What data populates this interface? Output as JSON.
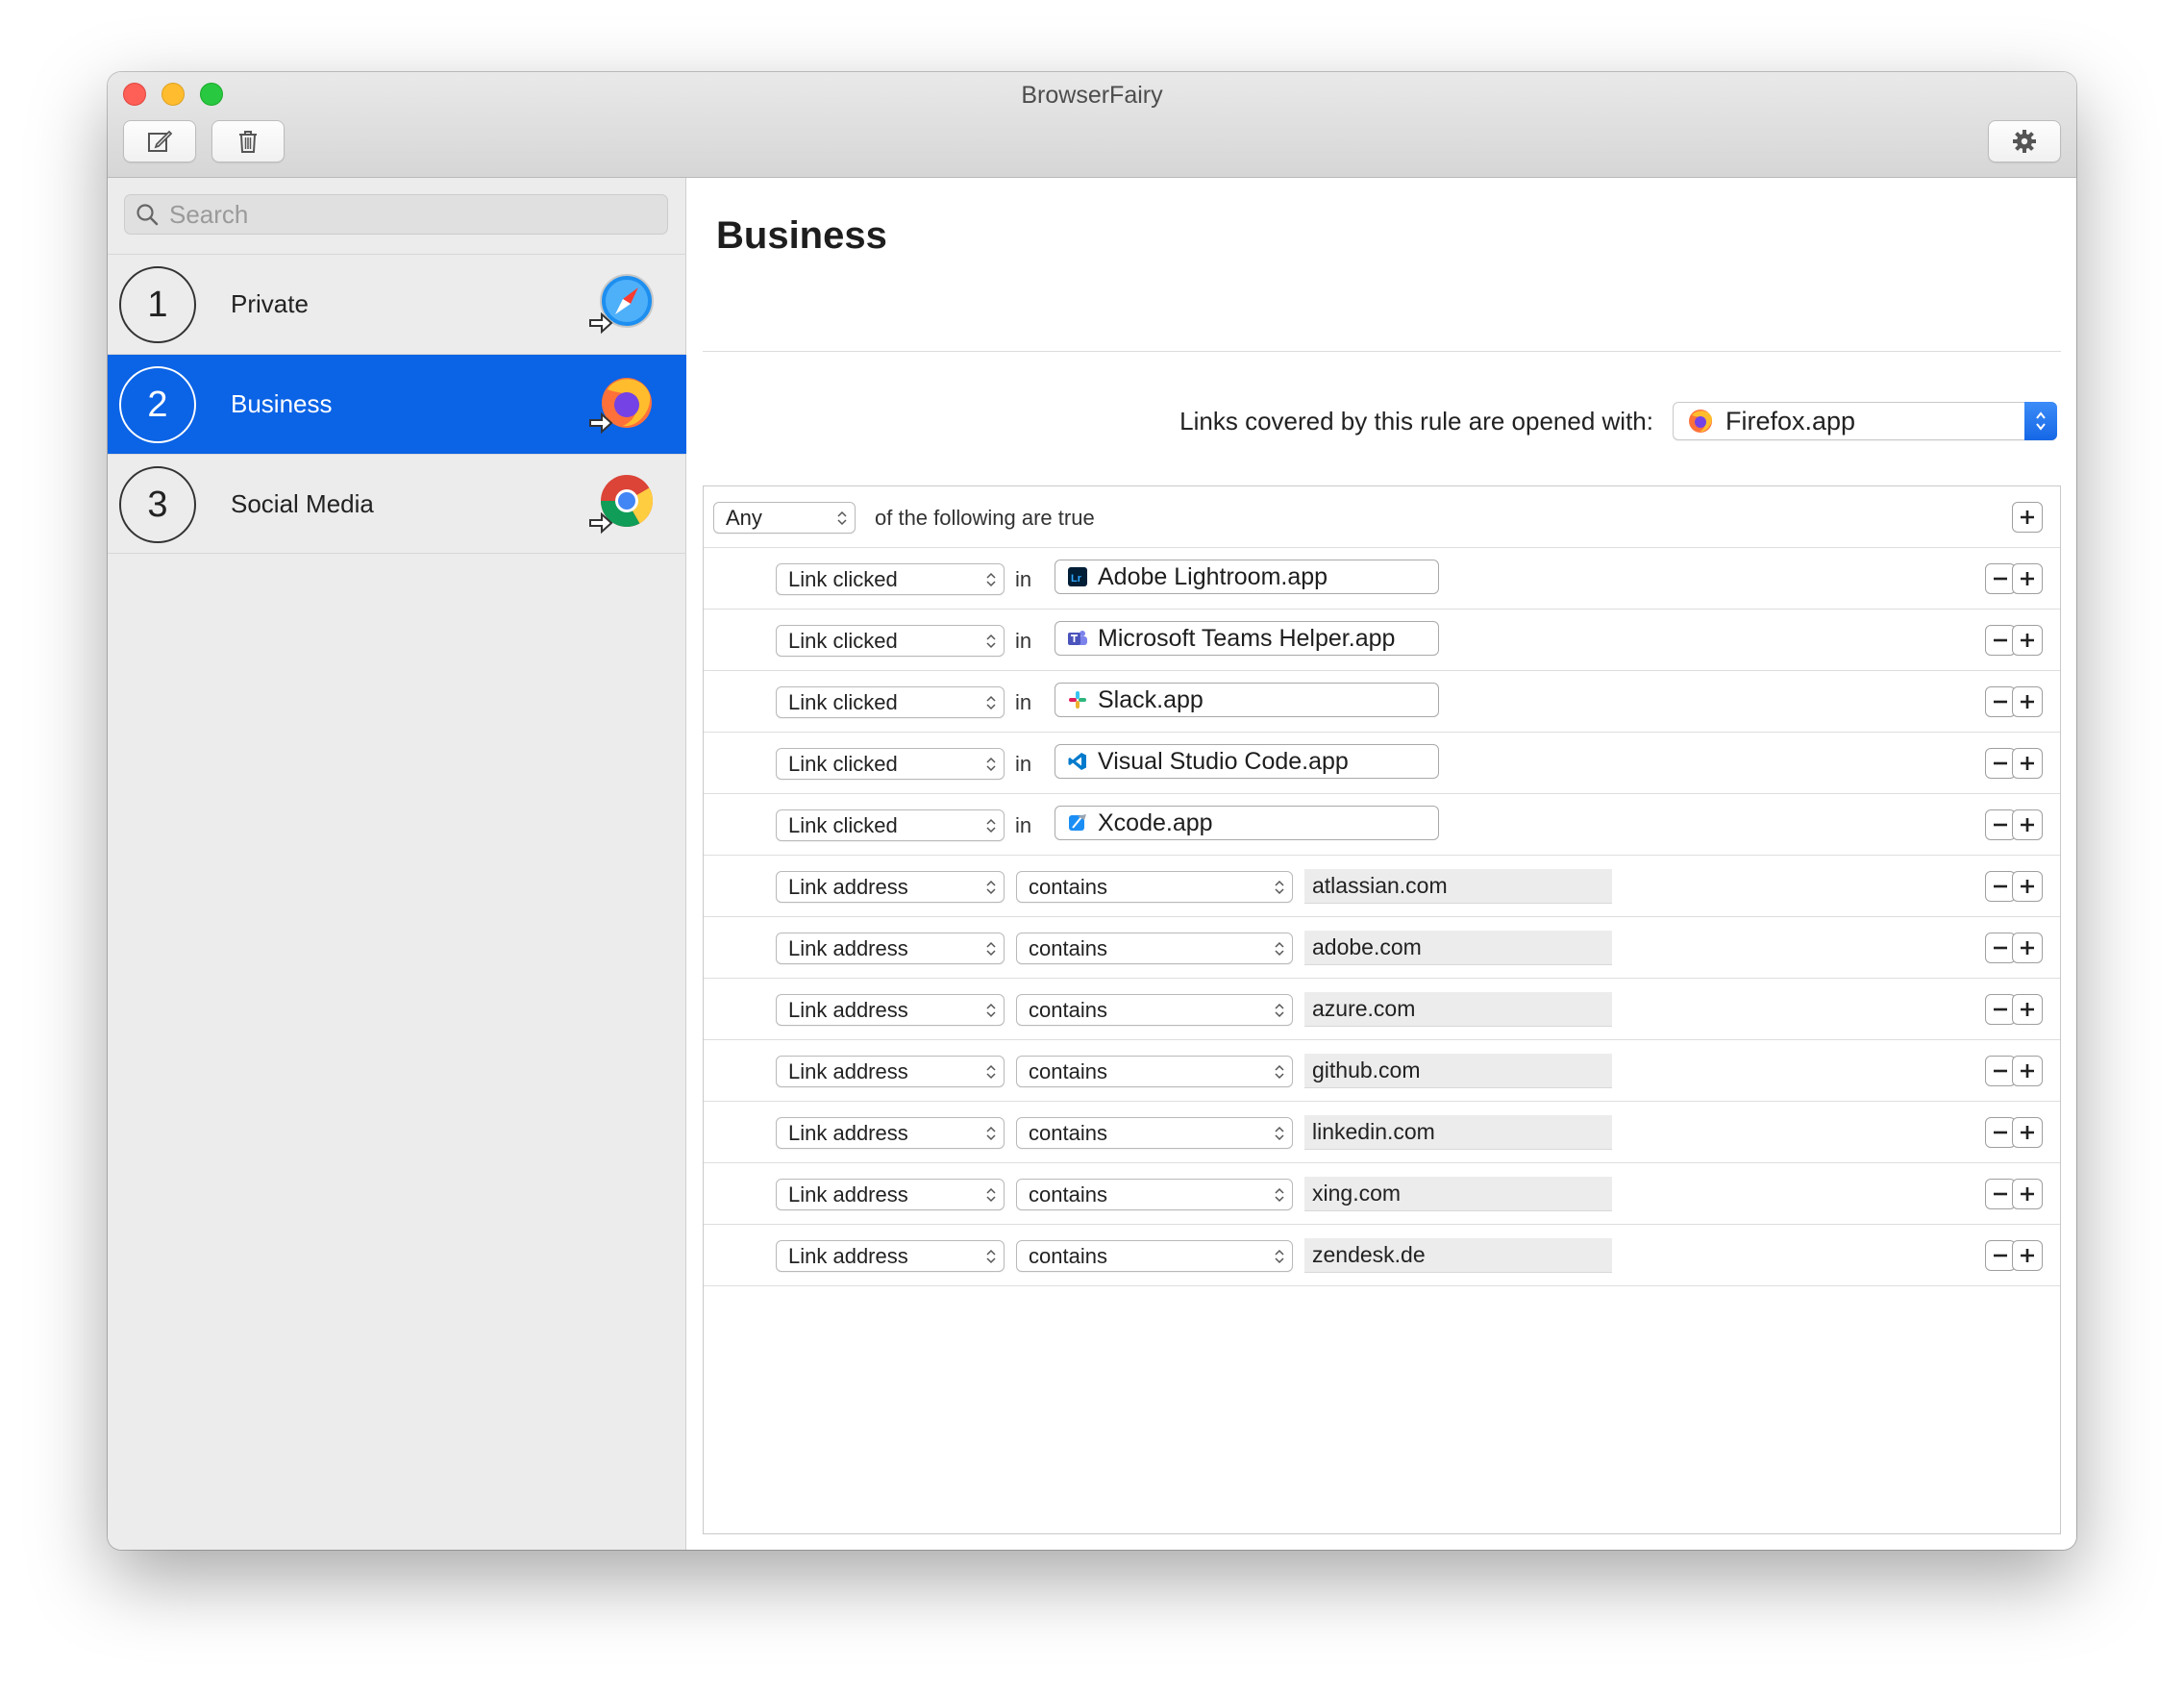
{
  "window": {
    "title": "BrowserFairy"
  },
  "toolbar": {
    "new_icon": "compose-icon",
    "delete_icon": "trash-icon",
    "settings_icon": "gear-icon"
  },
  "search": {
    "placeholder": "Search",
    "value": ""
  },
  "rules": [
    {
      "number": "1",
      "name": "Private",
      "browser_icon": "safari-icon",
      "selected": false
    },
    {
      "number": "2",
      "name": "Business",
      "browser_icon": "firefox-icon",
      "selected": true
    },
    {
      "number": "3",
      "name": "Social Media",
      "browser_icon": "chrome-icon",
      "selected": false
    }
  ],
  "detail": {
    "title": "Business",
    "opened_with_label": "Links covered by this rule are opened with:",
    "opened_with_app": "Firefox.app",
    "match_mode": "Any",
    "match_suffix": "of the following are true",
    "in_label": "in",
    "conditions_clicked": [
      {
        "kind": "Link clicked",
        "app": "Adobe Lightroom.app",
        "icon": "lightroom-icon"
      },
      {
        "kind": "Link clicked",
        "app": "Microsoft Teams Helper.app",
        "icon": "teams-icon"
      },
      {
        "kind": "Link clicked",
        "app": "Slack.app",
        "icon": "slack-icon"
      },
      {
        "kind": "Link clicked",
        "app": "Visual Studio Code.app",
        "icon": "vscode-icon"
      },
      {
        "kind": "Link clicked",
        "app": "Xcode.app",
        "icon": "xcode-icon"
      }
    ],
    "conditions_address": [
      {
        "kind": "Link address",
        "op": "contains",
        "value": "atlassian.com"
      },
      {
        "kind": "Link address",
        "op": "contains",
        "value": "adobe.com"
      },
      {
        "kind": "Link address",
        "op": "contains",
        "value": "azure.com"
      },
      {
        "kind": "Link address",
        "op": "contains",
        "value": "github.com"
      },
      {
        "kind": "Link address",
        "op": "contains",
        "value": "linkedin.com"
      },
      {
        "kind": "Link address",
        "op": "contains",
        "value": "xing.com"
      },
      {
        "kind": "Link address",
        "op": "contains",
        "value": "zendesk.de"
      }
    ]
  },
  "colors": {
    "selection": "#0b63e6",
    "accent": "#1667e6"
  }
}
